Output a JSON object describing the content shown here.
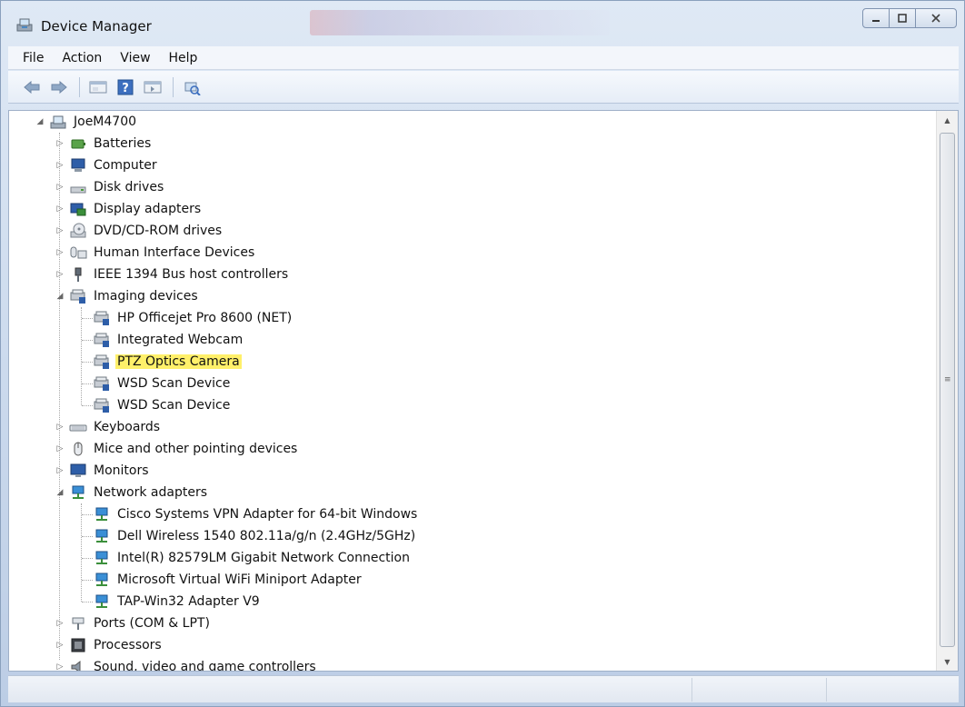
{
  "window": {
    "title": "Device Manager",
    "controls": [
      "minimize",
      "maximize",
      "close"
    ]
  },
  "menubar": {
    "items": [
      "File",
      "Action",
      "View",
      "Help"
    ]
  },
  "toolbar": {
    "buttons": [
      "back-icon",
      "forward-icon",
      "properties-icon",
      "help-icon",
      "show-hidden-icon",
      "scan-hardware-icon"
    ]
  },
  "tree": {
    "root": "JoeM4700",
    "categories": [
      {
        "label": "Batteries",
        "icon": "battery-icon",
        "expanded": false
      },
      {
        "label": "Computer",
        "icon": "computer-icon",
        "expanded": false
      },
      {
        "label": "Disk drives",
        "icon": "disk-drive-icon",
        "expanded": false
      },
      {
        "label": "Display adapters",
        "icon": "display-adapter-icon",
        "expanded": false
      },
      {
        "label": "DVD/CD-ROM drives",
        "icon": "dvd-drive-icon",
        "expanded": false
      },
      {
        "label": "Human Interface Devices",
        "icon": "hid-icon",
        "expanded": false
      },
      {
        "label": "IEEE 1394 Bus host controllers",
        "icon": "ieee1394-icon",
        "expanded": false
      },
      {
        "label": "Imaging devices",
        "icon": "imaging-device-icon",
        "expanded": true,
        "children": [
          {
            "label": "HP Officejet Pro 8600 (NET)",
            "highlighted": false
          },
          {
            "label": "Integrated Webcam",
            "highlighted": false
          },
          {
            "label": "PTZ Optics Camera",
            "highlighted": true
          },
          {
            "label": "WSD Scan Device",
            "highlighted": false
          },
          {
            "label": "WSD Scan Device",
            "highlighted": false
          }
        ]
      },
      {
        "label": "Keyboards",
        "icon": "keyboard-icon",
        "expanded": false
      },
      {
        "label": "Mice and other pointing devices",
        "icon": "mouse-icon",
        "expanded": false
      },
      {
        "label": "Monitors",
        "icon": "monitor-icon",
        "expanded": false
      },
      {
        "label": "Network adapters",
        "icon": "network-adapter-icon",
        "expanded": true,
        "children": [
          {
            "label": "Cisco Systems VPN Adapter for 64-bit Windows",
            "highlighted": false
          },
          {
            "label": "Dell Wireless 1540 802.11a/g/n (2.4GHz/5GHz)",
            "highlighted": false
          },
          {
            "label": "Intel(R) 82579LM Gigabit Network Connection",
            "highlighted": false
          },
          {
            "label": "Microsoft Virtual WiFi Miniport Adapter",
            "highlighted": false
          },
          {
            "label": "TAP-Win32 Adapter V9",
            "highlighted": false
          }
        ]
      },
      {
        "label": "Ports (COM & LPT)",
        "icon": "port-icon",
        "expanded": false
      },
      {
        "label": "Processors",
        "icon": "processor-icon",
        "expanded": false
      },
      {
        "label": "Sound, video and game controllers",
        "icon": "sound-icon",
        "expanded": false
      }
    ]
  },
  "colors": {
    "highlight": "#fff06a",
    "frame": "#c9d8ec"
  }
}
